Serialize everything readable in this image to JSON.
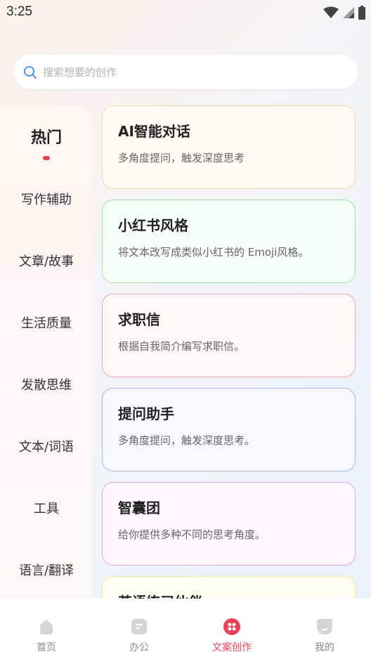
{
  "status": {
    "time": "3:25"
  },
  "search": {
    "placeholder": "搜索想要的创作"
  },
  "sidebar": {
    "items": [
      {
        "label": "热门",
        "active": true
      },
      {
        "label": "写作辅助"
      },
      {
        "label": "文章/故事"
      },
      {
        "label": "生活质量"
      },
      {
        "label": "发散思维"
      },
      {
        "label": "文本/词语"
      },
      {
        "label": "工具"
      },
      {
        "label": "语言/翻译"
      }
    ]
  },
  "cards": [
    {
      "title": "AI智能对话",
      "desc": "多角度提问，触发深度思考",
      "border": "#f5d6a8",
      "bg": "#fffbf4"
    },
    {
      "title": "小红书风格",
      "desc": "将文本改写成类似小红书的 Emoji风格。",
      "border": "#9ee6a7",
      "bg": "#f6fdf8"
    },
    {
      "title": "求职信",
      "desc": "根据自我简介编写求职信。",
      "border": "#f2a4b4",
      "bg": "#fff7f8"
    },
    {
      "title": "提问助手",
      "desc": "多角度提问，触发深度思考。",
      "border": "#a7b8f0",
      "bg": "#f7f8fd"
    },
    {
      "title": "智囊团",
      "desc": "给你提供多种不同的思考角度。",
      "border": "#e7a6e3",
      "bg": "#fdf6fc"
    },
    {
      "title": "英语练习伙伴",
      "desc": "",
      "border": "#f6e6a6",
      "bg": "#fffdf3"
    }
  ],
  "bottom_nav": [
    {
      "label": "首页",
      "icon": "home-icon"
    },
    {
      "label": "办公",
      "icon": "office-icon"
    },
    {
      "label": "文案创作",
      "icon": "creation-icon",
      "active": true
    },
    {
      "label": "我的",
      "icon": "profile-icon"
    }
  ],
  "colors": {
    "accent": "#e9435a"
  }
}
